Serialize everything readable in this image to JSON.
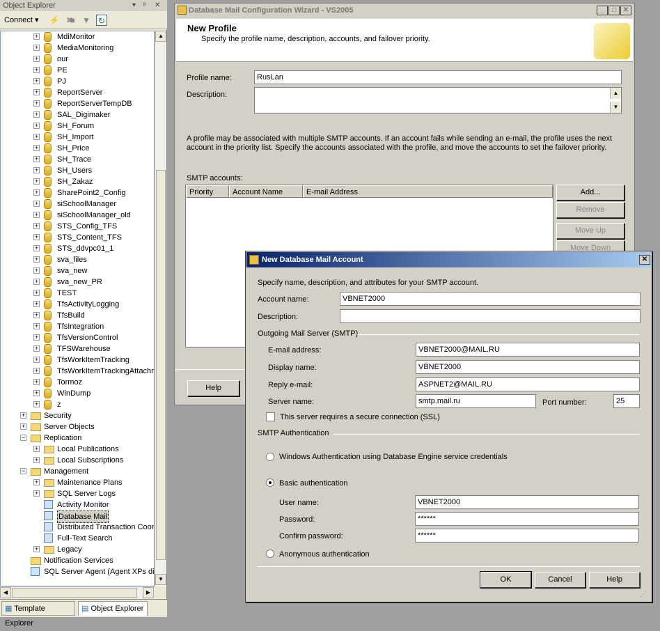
{
  "object_explorer": {
    "title": "Object Explorer",
    "title_controls": [
      "▾",
      "ᵖ",
      "✕"
    ],
    "connect_label": "Connect ▾",
    "tree": [
      {
        "label": "MdiMonitor",
        "type": "db",
        "level": 2
      },
      {
        "label": "MediaMonitoring",
        "type": "db",
        "level": 2
      },
      {
        "label": "our",
        "type": "db",
        "level": 2
      },
      {
        "label": "PE",
        "type": "db",
        "level": 2
      },
      {
        "label": "PJ",
        "type": "db",
        "level": 2
      },
      {
        "label": "ReportServer",
        "type": "db",
        "level": 2
      },
      {
        "label": "ReportServerTempDB",
        "type": "db",
        "level": 2
      },
      {
        "label": "SAL_Digimaker",
        "type": "db",
        "level": 2
      },
      {
        "label": "SH_Forum",
        "type": "db",
        "level": 2
      },
      {
        "label": "SH_Import",
        "type": "db",
        "level": 2
      },
      {
        "label": "SH_Price",
        "type": "db",
        "level": 2
      },
      {
        "label": "SH_Trace",
        "type": "db",
        "level": 2
      },
      {
        "label": "SH_Users",
        "type": "db",
        "level": 2
      },
      {
        "label": "SH_Zakaz",
        "type": "db",
        "level": 2
      },
      {
        "label": "SharePoint2_Config",
        "type": "db",
        "level": 2
      },
      {
        "label": "siSchoolManager",
        "type": "db",
        "level": 2
      },
      {
        "label": "siSchoolManager_old",
        "type": "db",
        "level": 2
      },
      {
        "label": "STS_Config_TFS",
        "type": "db",
        "level": 2
      },
      {
        "label": "STS_Content_TFS",
        "type": "db",
        "level": 2
      },
      {
        "label": "STS_ddvpc01_1",
        "type": "db",
        "level": 2
      },
      {
        "label": "sva_files",
        "type": "db",
        "level": 2
      },
      {
        "label": "sva_new",
        "type": "db",
        "level": 2
      },
      {
        "label": "sva_new_PR",
        "type": "db",
        "level": 2
      },
      {
        "label": "TEST",
        "type": "db",
        "level": 2
      },
      {
        "label": "TfsActivityLogging",
        "type": "db",
        "level": 2
      },
      {
        "label": "TfsBuild",
        "type": "db",
        "level": 2
      },
      {
        "label": "TfsIntegration",
        "type": "db",
        "level": 2
      },
      {
        "label": "TfsVersionControl",
        "type": "db",
        "level": 2
      },
      {
        "label": "TFSWarehouse",
        "type": "db",
        "level": 2
      },
      {
        "label": "TfsWorkItemTracking",
        "type": "db",
        "level": 2
      },
      {
        "label": "TfsWorkItemTrackingAttachn",
        "type": "db",
        "level": 2
      },
      {
        "label": "Tormoz",
        "type": "db",
        "level": 2
      },
      {
        "label": "WinDump",
        "type": "db",
        "level": 2
      },
      {
        "label": "z",
        "type": "db",
        "level": 2
      },
      {
        "label": "Security",
        "type": "folder",
        "level": 1,
        "exp": "+"
      },
      {
        "label": "Server Objects",
        "type": "folder",
        "level": 1,
        "exp": "+"
      },
      {
        "label": "Replication",
        "type": "folder",
        "level": 1,
        "exp": "−"
      },
      {
        "label": "Local Publications",
        "type": "folder",
        "level": 2,
        "exp": "+"
      },
      {
        "label": "Local Subscriptions",
        "type": "folder",
        "level": 2,
        "exp": "+"
      },
      {
        "label": "Management",
        "type": "folder",
        "level": 1,
        "exp": "−"
      },
      {
        "label": "Maintenance Plans",
        "type": "folder",
        "level": 2,
        "exp": "+"
      },
      {
        "label": "SQL Server Logs",
        "type": "folder",
        "level": 2,
        "exp": "+"
      },
      {
        "label": "Activity Monitor",
        "type": "tool",
        "level": 2
      },
      {
        "label": "Database Mail",
        "type": "tool",
        "level": 2,
        "selected": true
      },
      {
        "label": "Distributed Transaction Coor",
        "type": "tool",
        "level": 2
      },
      {
        "label": "Full-Text Search",
        "type": "tool",
        "level": 2
      },
      {
        "label": "Legacy",
        "type": "folder",
        "level": 2,
        "exp": "+"
      },
      {
        "label": "Notification Services",
        "type": "folder",
        "level": 1
      },
      {
        "label": "SQL Server Agent (Agent XPs dis",
        "type": "tool",
        "level": 1
      }
    ],
    "tabs": [
      "Template Explorer",
      "Object Explorer"
    ]
  },
  "wizard": {
    "title": "Database Mail Configuration Wizard - VS2005",
    "header_title": "New Profile",
    "header_subtitle": "Specify the profile name, description, accounts, and failover priority.",
    "profile_name_label": "Profile name:",
    "profile_name_value": "RusLan",
    "description_label": "Description:",
    "info_text_1": "A profile may be associated with multiple SMTP accounts. If an account fails while sending an e-mail, the profile uses the next",
    "info_text_2": "account in the priority list. Specify the accounts associated with the profile, and move the accounts to set the failover priority.",
    "smtp_accounts_label": "SMTP accounts:",
    "columns": [
      "Priority",
      "Account Name",
      "E-mail Address"
    ],
    "add_label": "Add...",
    "remove_label": "Remove",
    "move_up_label": "Move Up",
    "move_down_label": "Move Down",
    "help_label": "Help"
  },
  "dialog": {
    "title": "New Database Mail Account",
    "intro": "Specify name, description, and attributes for your SMTP account.",
    "account_name_label": "Account name:",
    "account_name_value": "VBNET2000",
    "description_label": "Description:",
    "description_value": "",
    "outgoing_label": "Outgoing Mail Server (SMTP)",
    "email_label": "E-mail address:",
    "email_value": "VBNET2000@MAIL.RU",
    "display_label": "Display name:",
    "display_value": "VBNET2000",
    "reply_label": "Reply e-mail:",
    "reply_value": "ASPNET2@MAIL.RU",
    "server_label": "Server name:",
    "server_value": "smtp.mail.ru",
    "port_label": "Port number:",
    "port_value": "25",
    "ssl_label": "This server requires a secure connection (SSL)",
    "auth_label": "SMTP Authentication",
    "windows_auth_label": "Windows Authentication using Database Engine service credentials",
    "basic_auth_label": "Basic authentication",
    "user_label": "User name:",
    "user_value": "VBNET2000",
    "password_label": "Password:",
    "password_value": "******",
    "confirm_label": "Confirm password:",
    "confirm_value": "******",
    "anon_label": "Anonymous authentication",
    "ok_label": "OK",
    "cancel_label": "Cancel",
    "help_label": "Help",
    "selected_auth": "basic"
  }
}
